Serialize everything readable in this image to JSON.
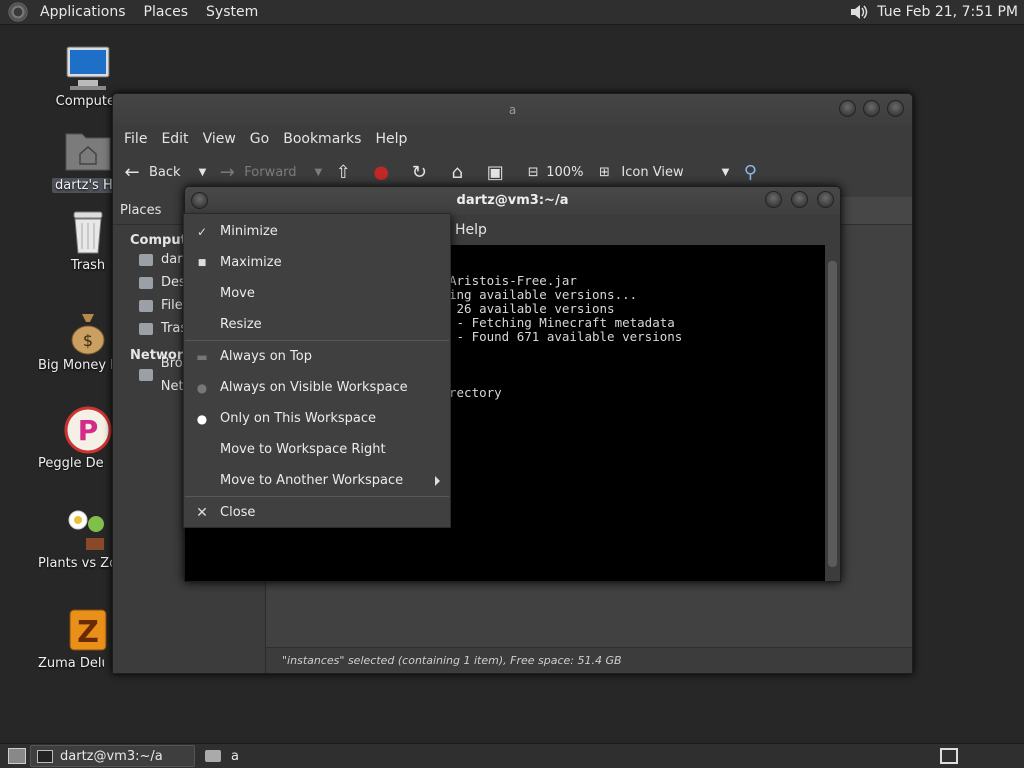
{
  "top_panel": {
    "menus": [
      "Applications",
      "Places",
      "System"
    ],
    "clock": "Tue Feb 21,  7:51 PM"
  },
  "desktop_icons": [
    {
      "label": "Computer",
      "icon": "computer-icon"
    },
    {
      "label": "dartz's Home",
      "icon": "home-folder-icon"
    },
    {
      "label": "Trash",
      "icon": "trash-icon"
    },
    {
      "label": "Big Money Deluxe",
      "icon": "money-bag-icon"
    },
    {
      "label": "Peggle Deluxe",
      "icon": "peggle-icon"
    },
    {
      "label": "Plants vs Zombies",
      "icon": "flower-icon"
    },
    {
      "label": "Zuma Deluxe",
      "icon": "zuma-icon"
    }
  ],
  "file_manager": {
    "title": "a",
    "menu": [
      "File",
      "Edit",
      "View",
      "Go",
      "Bookmarks",
      "Help"
    ],
    "toolbar": {
      "back": "Back",
      "forward": "Forward",
      "zoom": "100%",
      "view_mode": "Icon View"
    },
    "sidebar": {
      "header": "Places",
      "section_computer": "Computer",
      "computer_items": [
        "dartz",
        "Desktop",
        "File System",
        "Trash"
      ],
      "section_network": "Network",
      "network_items": [
        "Browse Network"
      ]
    },
    "status": "\"instances\" selected (containing 1 item), Free space: 51.4 GB"
  },
  "terminal": {
    "title": "dartz@vm3:~/a",
    "menu_help": "Help",
    "lines": [
      "Aristois-Free.jar",
      "ing available versions...",
      " 26 available versions",
      " - Fetching Minecraft metadata",
      " - Found 671 available versions",
      "rectory"
    ]
  },
  "context_menu": {
    "items": [
      {
        "label": "Minimize",
        "mark": "minimize"
      },
      {
        "label": "Maximize",
        "mark": "maximize"
      },
      {
        "label": "Move",
        "mark": ""
      },
      {
        "label": "Resize",
        "mark": ""
      },
      {
        "label": "Always on Top",
        "mark": "radio-off"
      },
      {
        "label": "Always on Visible Workspace",
        "mark": "radio-off"
      },
      {
        "label": "Only on This Workspace",
        "mark": "radio-on"
      },
      {
        "label": "Move to Workspace Right",
        "mark": ""
      },
      {
        "label": "Move to Another Workspace",
        "mark": "submenu"
      },
      {
        "label": "Close",
        "mark": "close"
      }
    ]
  },
  "bottom_panel": {
    "tasks": [
      "dartz@vm3:~/a",
      "a"
    ]
  }
}
